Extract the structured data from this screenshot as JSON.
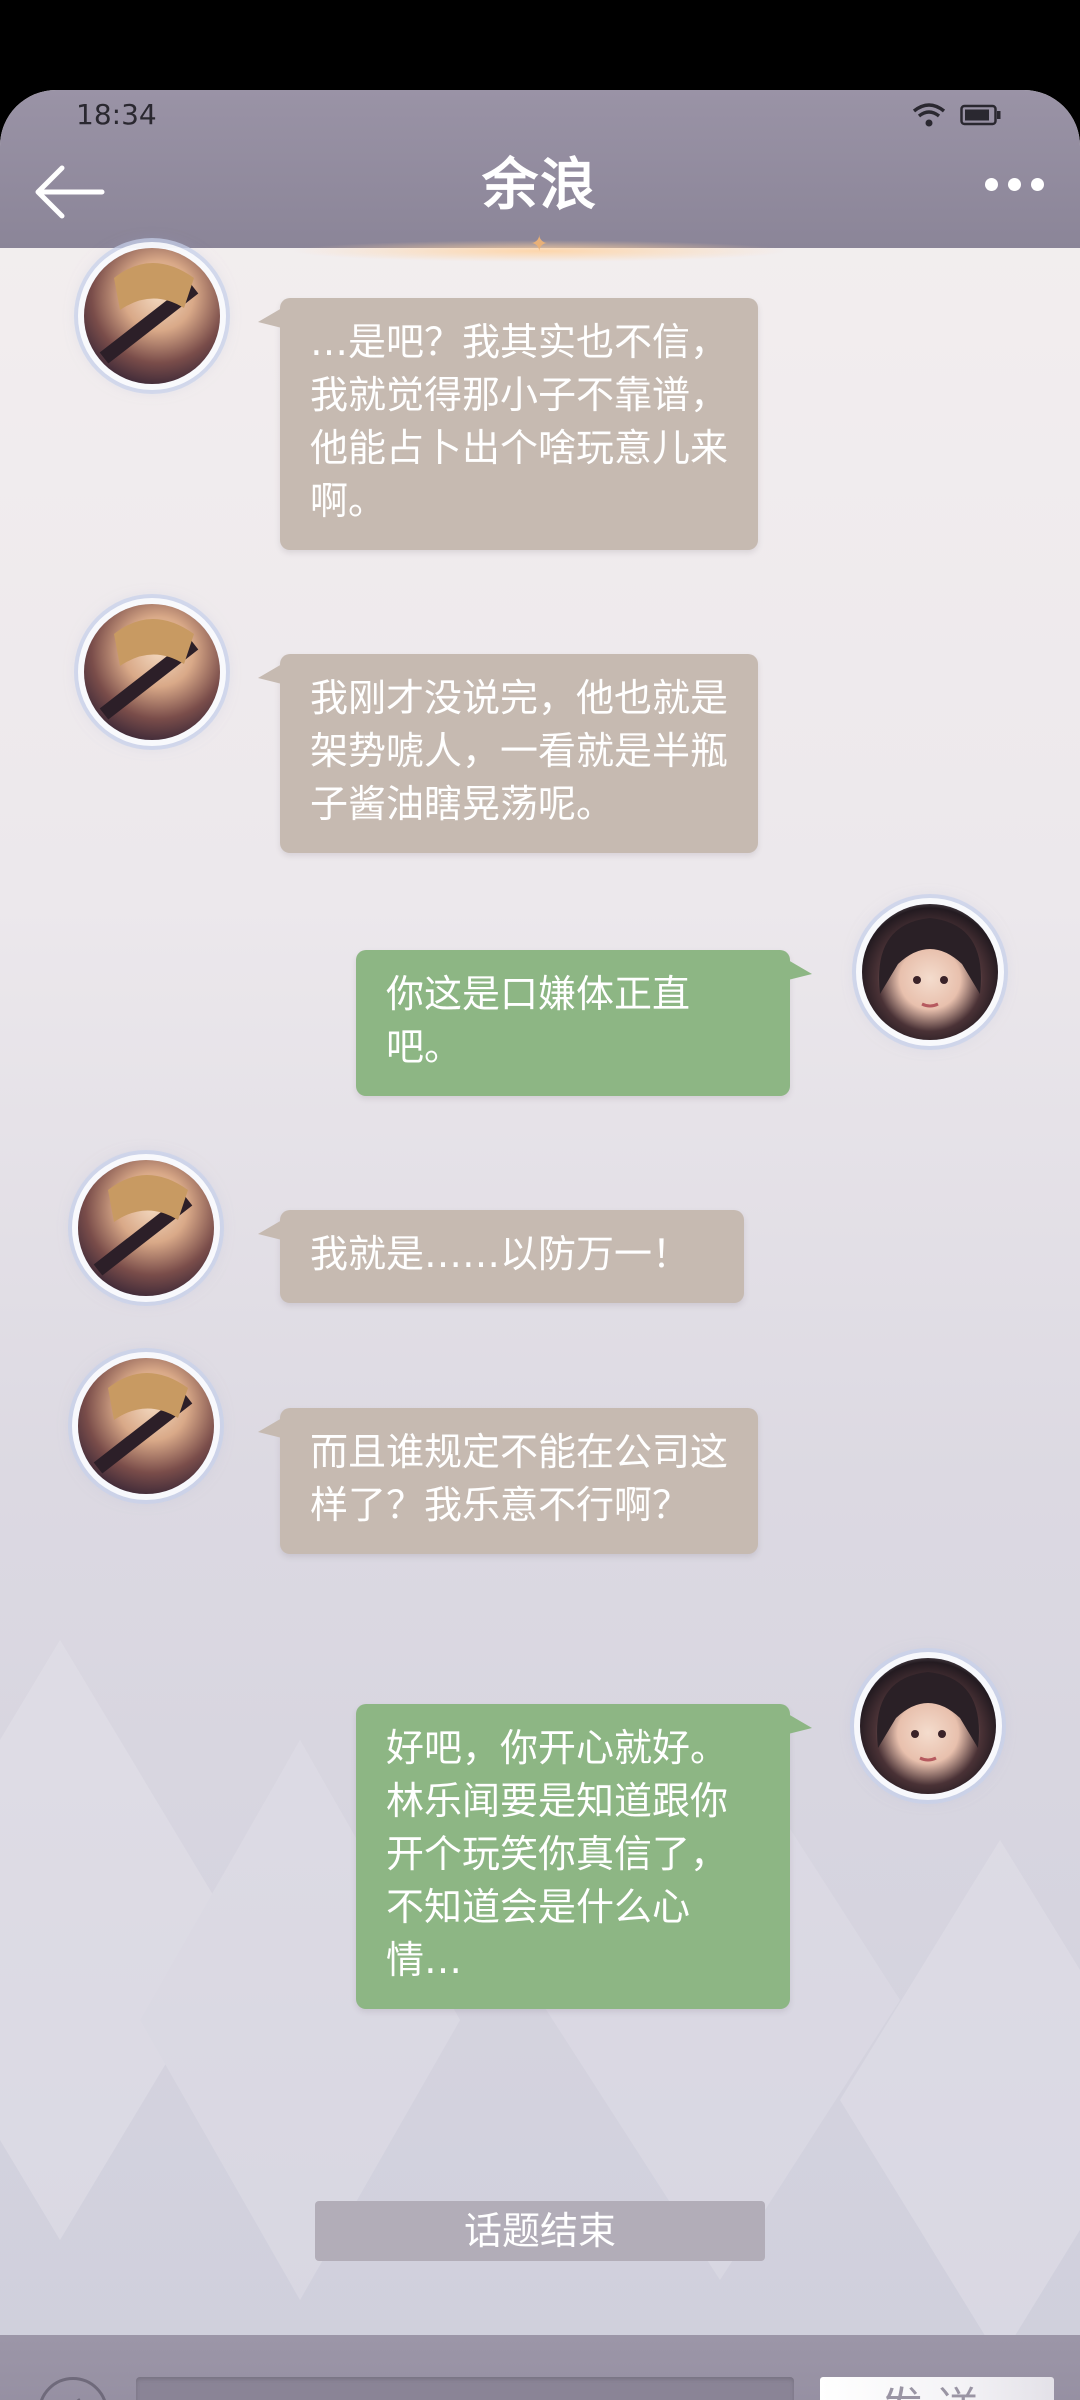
{
  "status_bar": {
    "time": "18:34"
  },
  "header": {
    "title": "余浪"
  },
  "messages": [
    {
      "side": "left",
      "text": "…是吧？我其实也不信，我就觉得那小子不靠谱，他能占卜出个啥玩意儿来啊。"
    },
    {
      "side": "left",
      "text": "我刚才没说完，他也就是架势唬人，一看就是半瓶子酱油瞎晃荡呢。"
    },
    {
      "side": "right",
      "text": "你这是口嫌体正直吧。"
    },
    {
      "side": "left",
      "text": "我就是……以防万一！"
    },
    {
      "side": "left",
      "text": "而且谁规定不能在公司这样了？我乐意不行啊？"
    },
    {
      "side": "right",
      "text": "好吧，你开心就好。林乐闻要是知道跟你开个玩笑你真信了，不知道会是什么心情…"
    }
  ],
  "topic_end": "话题结束",
  "input": {
    "value": "",
    "placeholder": ""
  },
  "send_label": "发送",
  "colors": {
    "left_bubble": "#c6bab1",
    "right_bubble": "#8db684",
    "header": "#8b8598"
  },
  "icons": {
    "back": "arrow-left-icon",
    "more": "more-dots-icon",
    "voice": "voice-icon",
    "wifi": "wifi-icon",
    "battery": "battery-icon"
  }
}
